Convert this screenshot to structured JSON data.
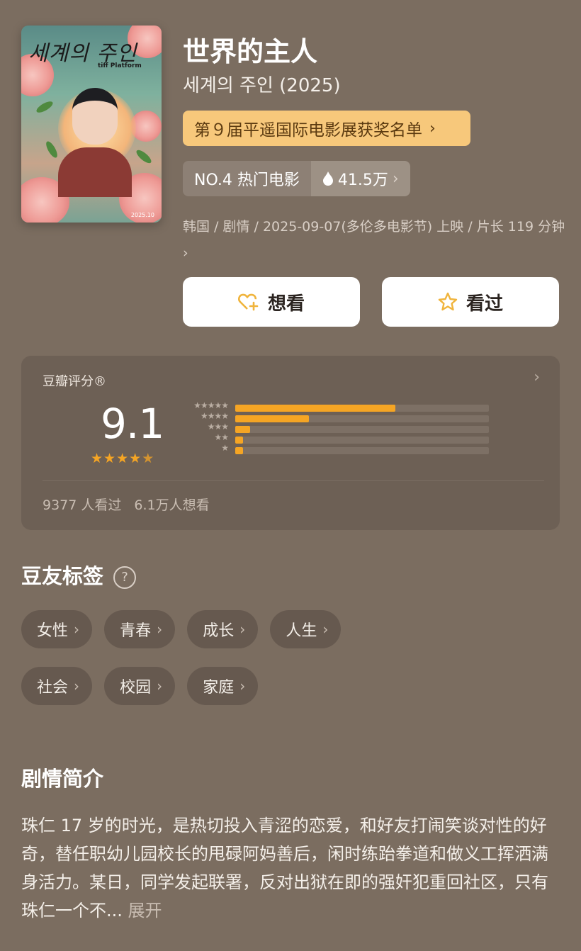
{
  "movie": {
    "title": "世界的主人",
    "original_title": "세계의 주인 (2025)",
    "poster": {
      "title_text": "세계의 주인",
      "badge_text": "tiff Platform",
      "date_text": "2025.10"
    },
    "award_text": "第９届平遥国际电影展获奖名单",
    "rank_text": "NO.4 热门电影",
    "heat_text": "41.5万",
    "meta_line": "韩国 / 剧情 / 2025-09-07(多伦多电影节) 上映 / 片长 119 分钟"
  },
  "actions": {
    "want_label": "想看",
    "seen_label": "看过"
  },
  "rating": {
    "label": "豆瓣评分®",
    "score": "9.1",
    "star_level": 4.5,
    "distribution": [
      {
        "stars": "★★★★★",
        "fraction": 0.63
      },
      {
        "stars": "★★★★",
        "fraction": 0.29
      },
      {
        "stars": "★★★",
        "fraction": 0.06
      },
      {
        "stars": "★★",
        "fraction": 0.03
      },
      {
        "stars": "★",
        "fraction": 0.03
      }
    ],
    "watched_text": "9377 人看过",
    "want_text": "6.1万人想看"
  },
  "tags_section": {
    "title": "豆友标签",
    "tags": [
      "女性",
      "青春",
      "成长",
      "人生",
      "社会",
      "校园",
      "家庭"
    ]
  },
  "synopsis": {
    "title": "剧情简介",
    "text": "珠仁 17 岁的时光，是热切投入青涩的恋爱，和好友打闹笑谈对性的好奇，替任职幼儿园校长的甩碌阿妈善后，闲时练跆拳道和做义工挥洒满身活力。某日，同学发起联署，反对出狱在即的强奸犯重回社区，只有珠仁一个不...",
    "more_label": "展开"
  },
  "colors": {
    "accent": "#f5a524",
    "award_bg": "#f7c87b",
    "background": "#7b6d60"
  }
}
